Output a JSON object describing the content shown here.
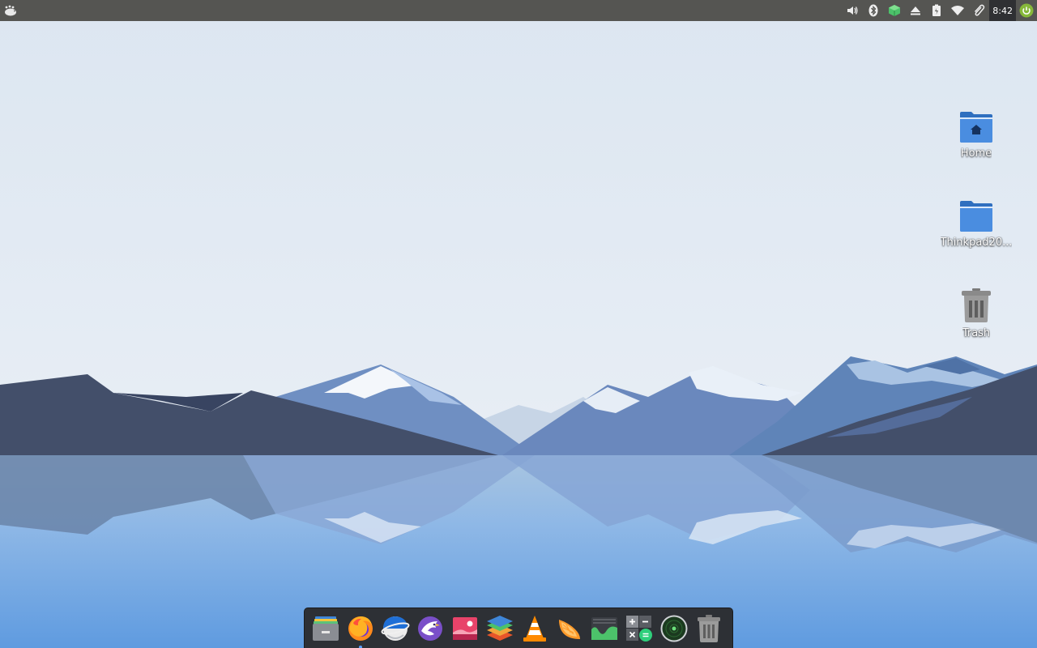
{
  "panel": {
    "clock": "8:42",
    "tray_icons": [
      "volume-icon",
      "bluetooth-icon",
      "package-updates-icon",
      "eject-icon",
      "battery-icon",
      "wifi-icon",
      "paperclip-icon"
    ]
  },
  "desktop": {
    "icons": [
      {
        "label": "Home",
        "icon": "home-folder-icon"
      },
      {
        "label": "Thinkpad20...",
        "icon": "folder-icon"
      },
      {
        "label": "Trash",
        "icon": "trash-icon"
      }
    ]
  },
  "dock": {
    "apps": [
      {
        "icon": "file-archiver-icon"
      },
      {
        "icon": "firefox-icon",
        "running": true
      },
      {
        "icon": "web-browser-icon"
      },
      {
        "icon": "mail-client-icon"
      },
      {
        "icon": "image-viewer-icon"
      },
      {
        "icon": "layers-icon"
      },
      {
        "icon": "vlc-icon"
      },
      {
        "icon": "orange-slice-icon"
      },
      {
        "icon": "system-monitor-icon"
      },
      {
        "icon": "calculator-icon"
      },
      {
        "icon": "radar-icon"
      },
      {
        "icon": "trash-icon"
      }
    ]
  },
  "colors": {
    "panel": "#555552",
    "sky_top": "#dde7f1",
    "water": "#7fb0e6",
    "dock": "#2d3035",
    "folder": "#4a8de0"
  }
}
